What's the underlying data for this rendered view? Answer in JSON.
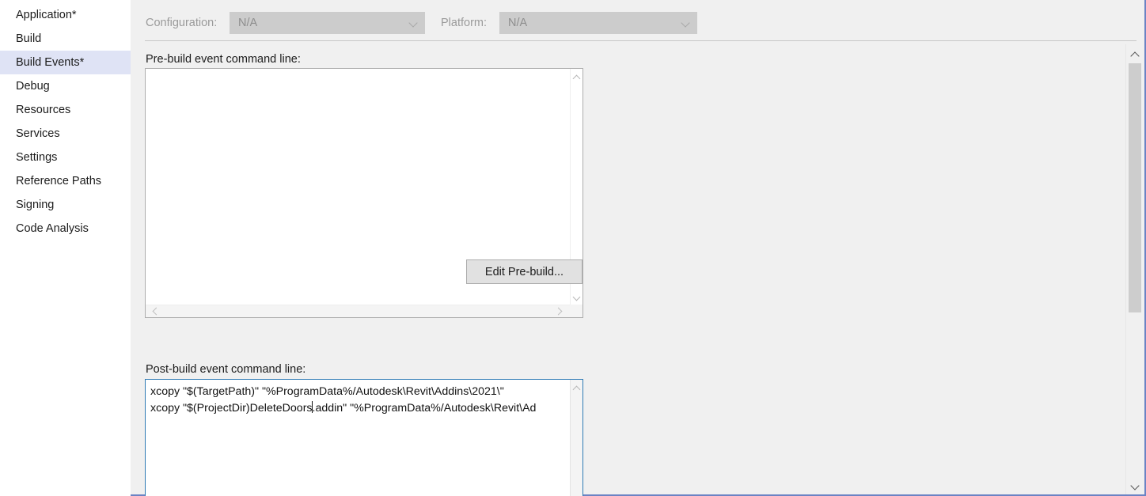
{
  "sidebar": {
    "items": [
      {
        "label": "Application*",
        "selected": false
      },
      {
        "label": "Build",
        "selected": false
      },
      {
        "label": "Build Events*",
        "selected": true
      },
      {
        "label": "Debug",
        "selected": false
      },
      {
        "label": "Resources",
        "selected": false
      },
      {
        "label": "Services",
        "selected": false
      },
      {
        "label": "Settings",
        "selected": false
      },
      {
        "label": "Reference Paths",
        "selected": false
      },
      {
        "label": "Signing",
        "selected": false
      },
      {
        "label": "Code Analysis",
        "selected": false
      }
    ]
  },
  "toolbar": {
    "configuration_label": "Configuration:",
    "configuration_value": "N/A",
    "platform_label": "Platform:",
    "platform_value": "N/A",
    "disabled": true
  },
  "prebuild": {
    "label": "Pre-build event command line:",
    "value": "",
    "edit_button_label": "Edit Pre-build..."
  },
  "postbuild": {
    "label": "Post-build event command line:",
    "line1": "xcopy \"$(TargetPath)\" \"%ProgramData%/Autodesk\\Revit\\Addins\\2021\\\"",
    "line2_before_caret": "xcopy \"$(ProjectDir)DeleteDoors",
    "line2_after_caret": ".addin\" \"%ProgramData%/Autodesk\\Revit\\Ad",
    "focused": true
  },
  "colors": {
    "selection": "#dfe3f5",
    "focus_border": "#2f7ab5",
    "window_border": "#6b83c4",
    "content_bg": "#f0f0f0",
    "disabled_combo": "#cccccc"
  },
  "icons": {
    "chevron_down": "chevron-down-icon",
    "chevron_up": "chevron-up-icon",
    "chevron_left": "chevron-left-icon",
    "chevron_right": "chevron-right-icon"
  }
}
